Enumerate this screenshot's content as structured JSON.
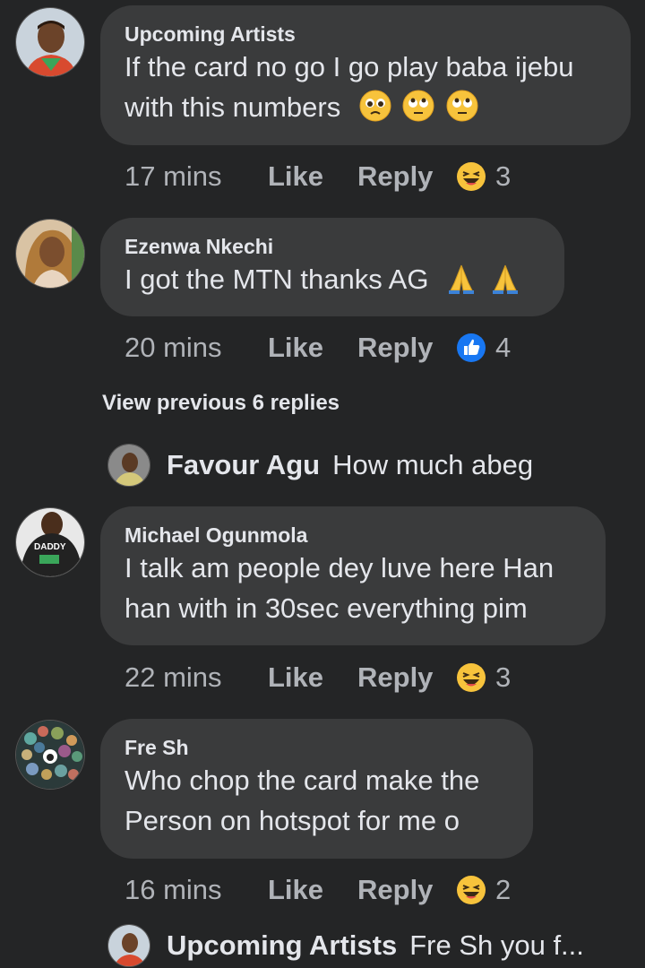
{
  "comments": [
    {
      "author": "Upcoming Artists",
      "line1": "If the card no go I go play baba ijebu",
      "line2": "with this numbers",
      "time": "17 mins",
      "like": "Like",
      "reply": "Reply",
      "reaction_icon": "laughing-emoji",
      "count": "3"
    },
    {
      "author": "Ezenwa Nkechi",
      "line1": "I got the MTN thanks AG",
      "time": "20 mins",
      "like": "Like",
      "reply": "Reply",
      "reaction_icon": "thumbs-up-like",
      "count": "4"
    },
    {
      "author": "Michael Ogunmola",
      "line1": "I talk am people dey luve here Han",
      "line2": "han with in 30sec everything pim",
      "time": "22 mins",
      "like": "Like",
      "reply": "Reply",
      "reaction_icon": "laughing-emoji",
      "count": "3"
    },
    {
      "author": "Fre Sh",
      "line1": "Who chop the card make the",
      "line2": "Person on hotspot for me o",
      "time": "16 mins",
      "like": "Like",
      "reply": "Reply",
      "reaction_icon": "laughing-emoji",
      "count": "2"
    }
  ],
  "view_previous": "View previous 6 replies",
  "replies": [
    {
      "author": "Favour Agu",
      "text": "How much abeg"
    },
    {
      "author": "Upcoming Artists",
      "text": "Fre Sh you f..."
    }
  ],
  "avatar_shirt_text": "DADDY",
  "colors": {
    "background": "#242526",
    "bubble": "#3a3b3c",
    "text": "#e4e6eb",
    "meta": "#b0b3b8",
    "like_blue": "#1877f2",
    "emoji_yellow": "#f7c33c"
  }
}
